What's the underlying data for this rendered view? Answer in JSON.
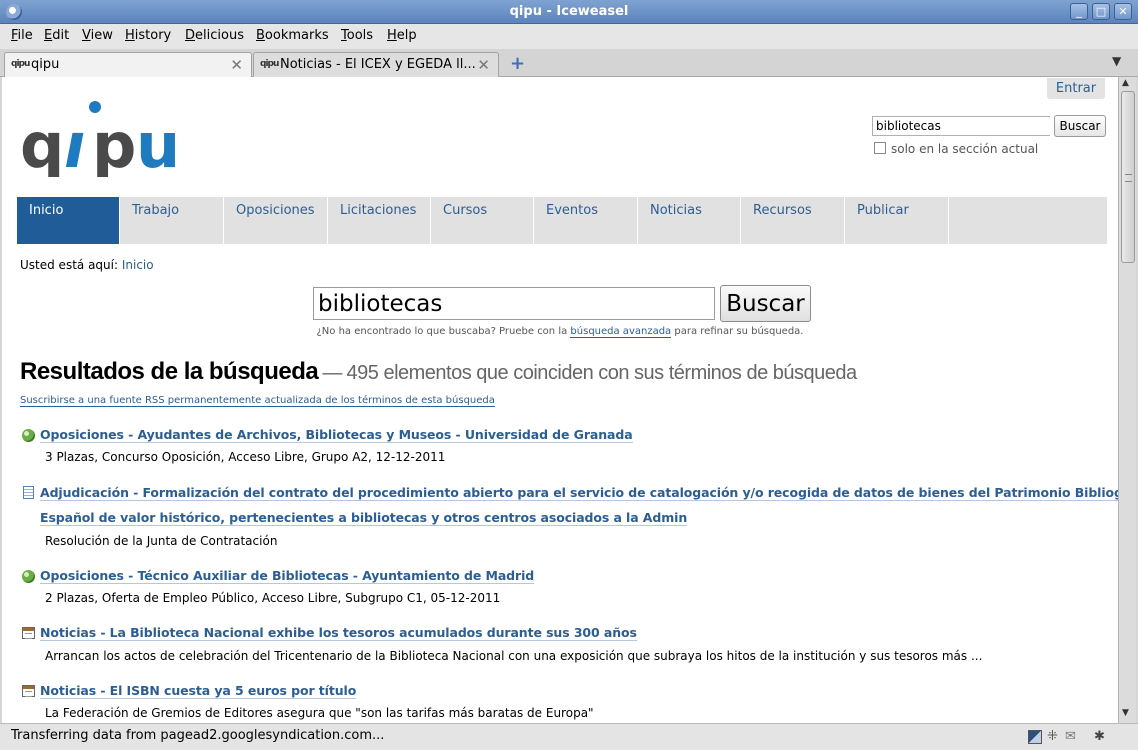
{
  "window": {
    "title": "qipu - Iceweasel",
    "min": "_",
    "max": "□",
    "close": "✕"
  },
  "menu": [
    "File",
    "Edit",
    "View",
    "History",
    "Delicious",
    "Bookmarks",
    "Tools",
    "Help"
  ],
  "tabs": [
    {
      "favicon": "qipu",
      "label": "qipu"
    },
    {
      "favicon": "qipu",
      "label": "Noticias - El ICEX y EGEDA ll..."
    }
  ],
  "page": {
    "login": "Entrar",
    "logo": "qipu",
    "top_search": {
      "value": "bibliotecas",
      "button": "Buscar",
      "checkbox_label": "solo en la sección actual"
    },
    "nav": [
      "Inicio",
      "Trabajo",
      "Oposiciones",
      "Licitaciones",
      "Cursos",
      "Eventos",
      "Noticias",
      "Recursos",
      "Publicar"
    ],
    "breadcrumb": {
      "prefix": "Usted está aquí:",
      "link": "Inicio"
    },
    "big_search": {
      "value": "bibliotecas",
      "button": "Buscar",
      "hint_before": "¿No ha encontrado lo que buscaba? Pruebe con la",
      "hint_link": "búsqueda avanzada",
      "hint_after": "para refinar su búsqueda."
    },
    "results_title": "Resultados de la búsqueda",
    "results_dash": "—",
    "results_count": "495 elementos que coinciden con sus términos de búsqueda",
    "rss_link": "Suscribirse a una fuente RSS permanentemente actualizada de los términos de esta búsqueda",
    "results": [
      {
        "icon": "globe-icon",
        "title_lines": [
          "Oposiciones - Ayudantes de Archivos, Bibliotecas y Museos - Universidad de Granada"
        ],
        "desc": "3 Plazas, Concurso Oposición, Acceso Libre, Grupo A2, 12-12-2011"
      },
      {
        "icon": "document-icon",
        "title_lines": [
          "Adjudicación - Formalización del contrato del procedimiento abierto para el servicio de catalogación y/o recogida de datos de bienes del Patrimonio Bibliográfico",
          "Español de valor histórico, pertenecientes a bibliotecas y otros centros asociados a la Admin"
        ],
        "desc": "Resolución de la Junta de Contratación"
      },
      {
        "icon": "globe-icon",
        "title_lines": [
          "Oposiciones - Técnico Auxiliar de Bibliotecas - Ayuntamiento de Madrid"
        ],
        "desc": "2 Plazas, Oferta de Empleo Público, Acceso Libre, Subgrupo C1, 05-12-2011"
      },
      {
        "icon": "news-icon",
        "title_lines": [
          "Noticias - La Biblioteca Nacional exhibe los tesoros acumulados durante sus 300 años"
        ],
        "desc": "Arrancan los actos de celebración del Tricentenario de la Biblioteca Nacional con una exposición que subraya los hitos de la institución y sus tesoros más ..."
      },
      {
        "icon": "news-icon",
        "title_lines": [
          "Noticias - El ISBN cuesta ya 5 euros por título"
        ],
        "desc": "La Federación de Gremios de Editores asegura que \"son las tarifas más baratas de Europa\""
      }
    ]
  },
  "status": {
    "text": "Transferring data from pagead2.googlesyndication.com..."
  },
  "colors": {
    "link": "#2c5e93",
    "nav_active": "#205c97",
    "logo_grey": "#4a4a4a",
    "logo_blue": "#1f7bbf"
  }
}
